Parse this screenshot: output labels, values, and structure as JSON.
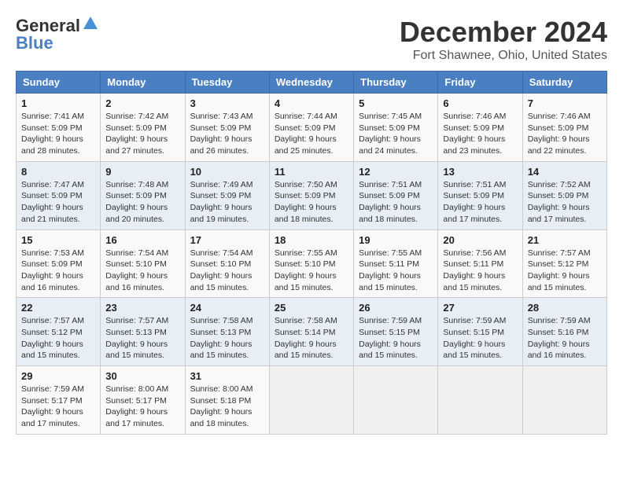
{
  "header": {
    "logo_line1": "General",
    "logo_line2": "Blue",
    "month_title": "December 2024",
    "location": "Fort Shawnee, Ohio, United States"
  },
  "weekdays": [
    "Sunday",
    "Monday",
    "Tuesday",
    "Wednesday",
    "Thursday",
    "Friday",
    "Saturday"
  ],
  "weeks": [
    [
      {
        "day": "1",
        "sunrise": "7:41 AM",
        "sunset": "5:09 PM",
        "daylight": "9 hours and 28 minutes."
      },
      {
        "day": "2",
        "sunrise": "7:42 AM",
        "sunset": "5:09 PM",
        "daylight": "9 hours and 27 minutes."
      },
      {
        "day": "3",
        "sunrise": "7:43 AM",
        "sunset": "5:09 PM",
        "daylight": "9 hours and 26 minutes."
      },
      {
        "day": "4",
        "sunrise": "7:44 AM",
        "sunset": "5:09 PM",
        "daylight": "9 hours and 25 minutes."
      },
      {
        "day": "5",
        "sunrise": "7:45 AM",
        "sunset": "5:09 PM",
        "daylight": "9 hours and 24 minutes."
      },
      {
        "day": "6",
        "sunrise": "7:46 AM",
        "sunset": "5:09 PM",
        "daylight": "9 hours and 23 minutes."
      },
      {
        "day": "7",
        "sunrise": "7:46 AM",
        "sunset": "5:09 PM",
        "daylight": "9 hours and 22 minutes."
      }
    ],
    [
      {
        "day": "8",
        "sunrise": "7:47 AM",
        "sunset": "5:09 PM",
        "daylight": "9 hours and 21 minutes."
      },
      {
        "day": "9",
        "sunrise": "7:48 AM",
        "sunset": "5:09 PM",
        "daylight": "9 hours and 20 minutes."
      },
      {
        "day": "10",
        "sunrise": "7:49 AM",
        "sunset": "5:09 PM",
        "daylight": "9 hours and 19 minutes."
      },
      {
        "day": "11",
        "sunrise": "7:50 AM",
        "sunset": "5:09 PM",
        "daylight": "9 hours and 18 minutes."
      },
      {
        "day": "12",
        "sunrise": "7:51 AM",
        "sunset": "5:09 PM",
        "daylight": "9 hours and 18 minutes."
      },
      {
        "day": "13",
        "sunrise": "7:51 AM",
        "sunset": "5:09 PM",
        "daylight": "9 hours and 17 minutes."
      },
      {
        "day": "14",
        "sunrise": "7:52 AM",
        "sunset": "5:09 PM",
        "daylight": "9 hours and 17 minutes."
      }
    ],
    [
      {
        "day": "15",
        "sunrise": "7:53 AM",
        "sunset": "5:09 PM",
        "daylight": "9 hours and 16 minutes."
      },
      {
        "day": "16",
        "sunrise": "7:54 AM",
        "sunset": "5:10 PM",
        "daylight": "9 hours and 16 minutes."
      },
      {
        "day": "17",
        "sunrise": "7:54 AM",
        "sunset": "5:10 PM",
        "daylight": "9 hours and 15 minutes."
      },
      {
        "day": "18",
        "sunrise": "7:55 AM",
        "sunset": "5:10 PM",
        "daylight": "9 hours and 15 minutes."
      },
      {
        "day": "19",
        "sunrise": "7:55 AM",
        "sunset": "5:11 PM",
        "daylight": "9 hours and 15 minutes."
      },
      {
        "day": "20",
        "sunrise": "7:56 AM",
        "sunset": "5:11 PM",
        "daylight": "9 hours and 15 minutes."
      },
      {
        "day": "21",
        "sunrise": "7:57 AM",
        "sunset": "5:12 PM",
        "daylight": "9 hours and 15 minutes."
      }
    ],
    [
      {
        "day": "22",
        "sunrise": "7:57 AM",
        "sunset": "5:12 PM",
        "daylight": "9 hours and 15 minutes."
      },
      {
        "day": "23",
        "sunrise": "7:57 AM",
        "sunset": "5:13 PM",
        "daylight": "9 hours and 15 minutes."
      },
      {
        "day": "24",
        "sunrise": "7:58 AM",
        "sunset": "5:13 PM",
        "daylight": "9 hours and 15 minutes."
      },
      {
        "day": "25",
        "sunrise": "7:58 AM",
        "sunset": "5:14 PM",
        "daylight": "9 hours and 15 minutes."
      },
      {
        "day": "26",
        "sunrise": "7:59 AM",
        "sunset": "5:15 PM",
        "daylight": "9 hours and 15 minutes."
      },
      {
        "day": "27",
        "sunrise": "7:59 AM",
        "sunset": "5:15 PM",
        "daylight": "9 hours and 15 minutes."
      },
      {
        "day": "28",
        "sunrise": "7:59 AM",
        "sunset": "5:16 PM",
        "daylight": "9 hours and 16 minutes."
      }
    ],
    [
      {
        "day": "29",
        "sunrise": "7:59 AM",
        "sunset": "5:17 PM",
        "daylight": "9 hours and 17 minutes."
      },
      {
        "day": "30",
        "sunrise": "8:00 AM",
        "sunset": "5:17 PM",
        "daylight": "9 hours and 17 minutes."
      },
      {
        "day": "31",
        "sunrise": "8:00 AM",
        "sunset": "5:18 PM",
        "daylight": "9 hours and 18 minutes."
      },
      null,
      null,
      null,
      null
    ]
  ],
  "labels": {
    "sunrise": "Sunrise:",
    "sunset": "Sunset:",
    "daylight": "Daylight hours"
  }
}
